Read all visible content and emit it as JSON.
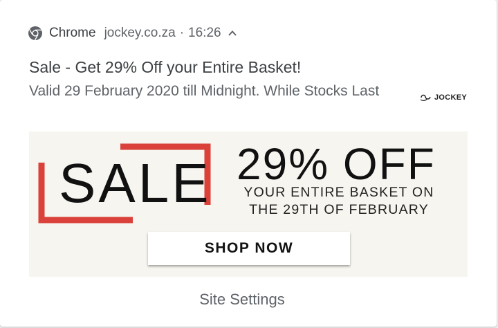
{
  "notification": {
    "app_name": "Chrome",
    "origin": "jockey.co.za",
    "separator": "·",
    "time": "16:26",
    "title": "Sale - Get 29% Off your Entire Basket!",
    "body": "Valid 29 February 2020 till Midnight. While Stocks Last",
    "brand_logo_text": "JOCKEY",
    "settings_label": "Site Settings"
  },
  "banner": {
    "sale_word": "SALE",
    "headline": "29% OFF",
    "subline_1": "YOUR ENTIRE BASKET ON",
    "subline_2": "THE 29TH OF FEBRUARY",
    "cta_label": "SHOP NOW",
    "frame_color": "#d9413a",
    "background_color": "#f6f5ef"
  }
}
